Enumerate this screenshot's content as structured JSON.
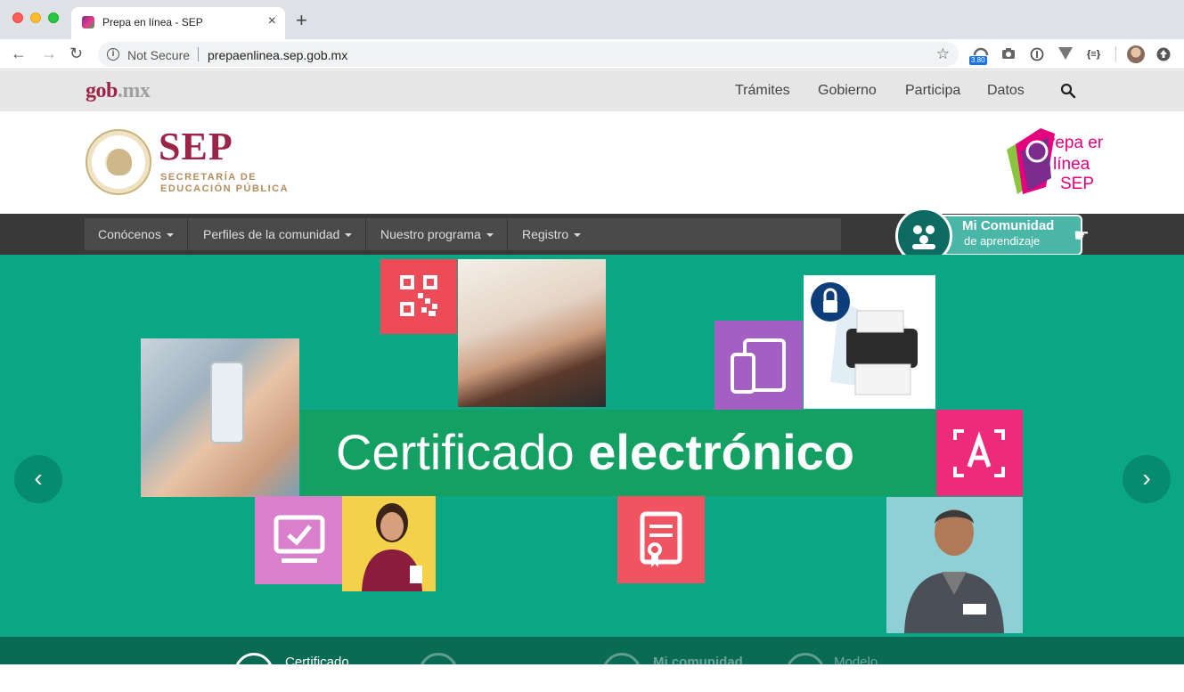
{
  "browser": {
    "tab_title": "Prepa en línea - SEP",
    "tab_close": "×",
    "new_tab": "+",
    "security_label": "Not Secure",
    "url": "prepaenlinea.sep.gob.mx",
    "ext_badge": "3.80",
    "ext_json": "{≡}"
  },
  "gob": {
    "logo_main": "gob",
    "logo_suffix": ".mx",
    "nav": [
      "Trámites",
      "Gobierno",
      "Participa",
      "Datos"
    ]
  },
  "header": {
    "sep": "SEP",
    "sep_line1": "SECRETARÍA DE",
    "sep_line2": "EDUCACIÓN PÚBLICA",
    "prepa_line1": "repa en",
    "prepa_line2": "línea",
    "prepa_line3": "SEP"
  },
  "menu": {
    "items": [
      "Conócenos",
      "Perfiles de la comunidad",
      "Nuestro programa",
      "Registro"
    ]
  },
  "comunidad": {
    "title": "Mi Comunidad",
    "subtitle": "de aprendizaje"
  },
  "hero": {
    "banner_light": "Certificado ",
    "banner_bold": "electrónico",
    "prev": "‹",
    "next": "›"
  },
  "bottom": {
    "item1": "Certificado",
    "item2": "Mi comunidad",
    "item3": "Modelo"
  },
  "colors": {
    "hero_bg": "#0ba784",
    "banner": "#15a063",
    "gob_brand": "#9d2449",
    "dark_nav": "#393939"
  }
}
